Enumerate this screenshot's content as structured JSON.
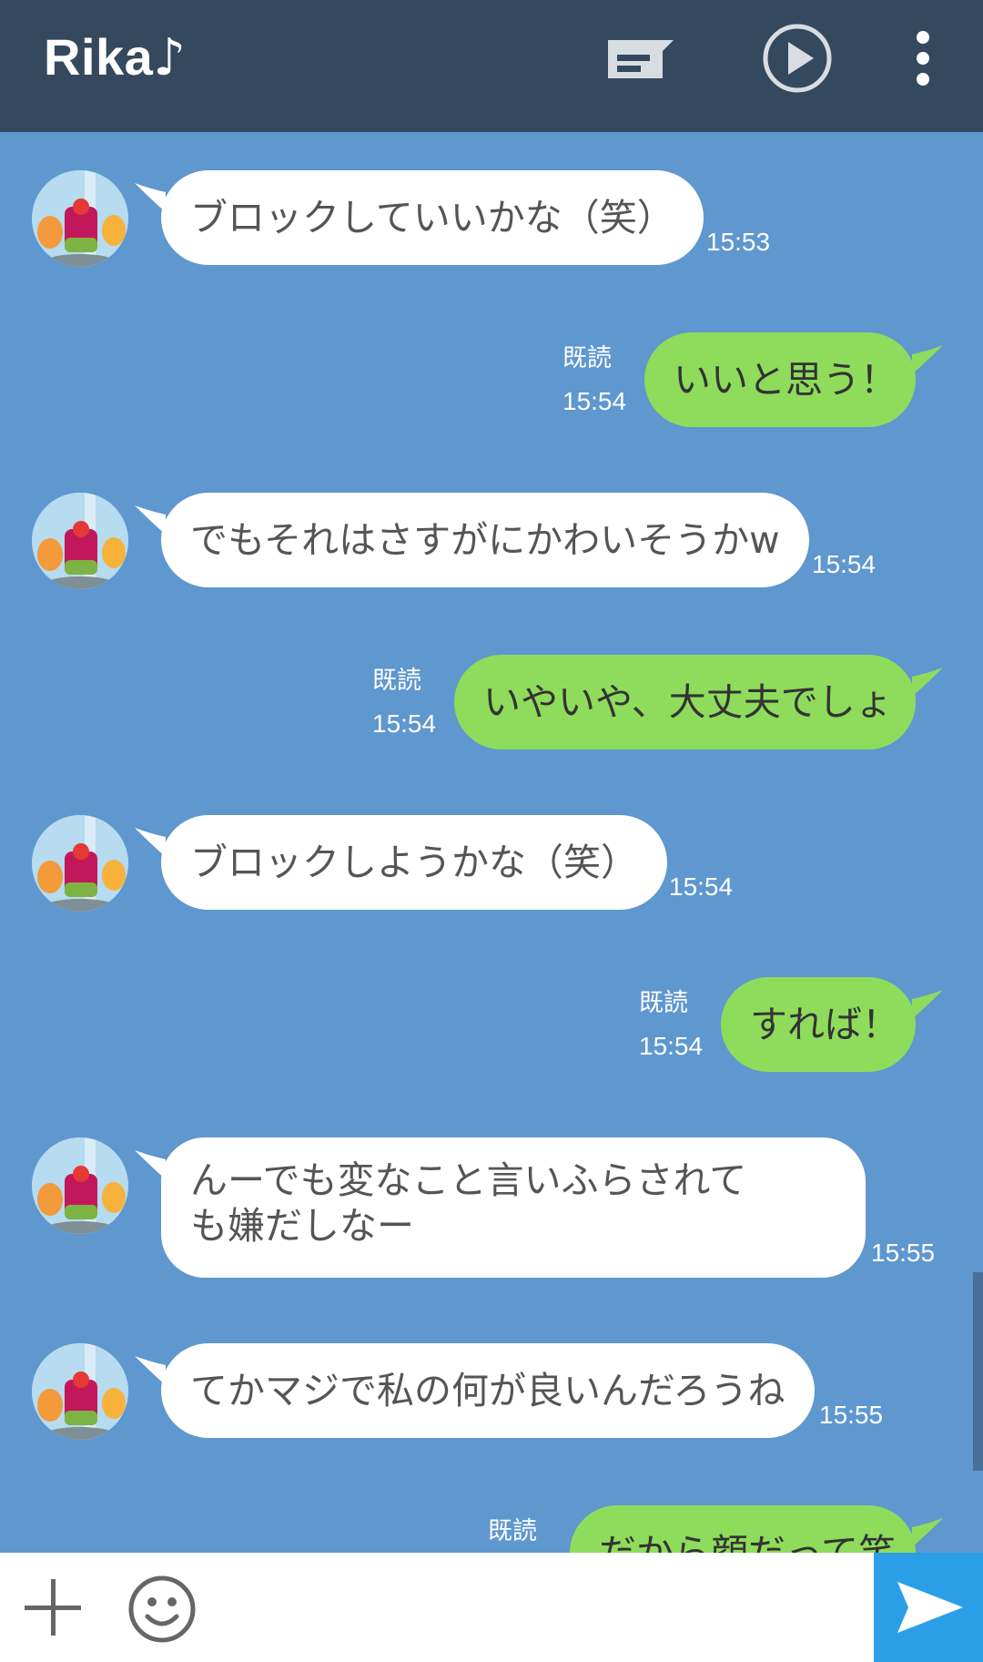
{
  "header": {
    "title": "Rika",
    "title_symbol": "♪",
    "icons": [
      "note-icon",
      "play-icon",
      "more-vert-icon"
    ],
    "bg_color": "#34495e"
  },
  "messages": [
    {
      "side": "in",
      "text": "ブロックしていいかな（笑）",
      "time": "15:53"
    },
    {
      "side": "out",
      "text": "いいと思う！",
      "read": "既読",
      "time": "15:54"
    },
    {
      "side": "in",
      "text": "でもそれはさすがにかわいそうかw",
      "time": "15:54"
    },
    {
      "side": "out",
      "text": "いやいや、大丈夫でしょ",
      "read": "既読",
      "time": "15:54"
    },
    {
      "side": "in",
      "text": "ブロックしようかな（笑）",
      "time": "15:54"
    },
    {
      "side": "out",
      "text": "すれば！",
      "read": "既読",
      "time": "15:54"
    },
    {
      "side": "in",
      "text": "んーでも変なこと言いふらされても嫌だしなー",
      "time": "15:55"
    },
    {
      "side": "in",
      "text": "てかマジで私の何が良いんだろうね",
      "time": "15:55"
    },
    {
      "side": "out",
      "text": "だから顔だって笑",
      "read": "既読"
    }
  ],
  "colors": {
    "chat_bg": "#5f97cf",
    "incoming_bubble": "#ffffff",
    "outgoing_bubble": "#8fdc5c",
    "send_button": "#2a9fe8"
  },
  "input_bar": {
    "icons": [
      "plus-icon",
      "emoji-icon",
      "send-icon"
    ]
  }
}
